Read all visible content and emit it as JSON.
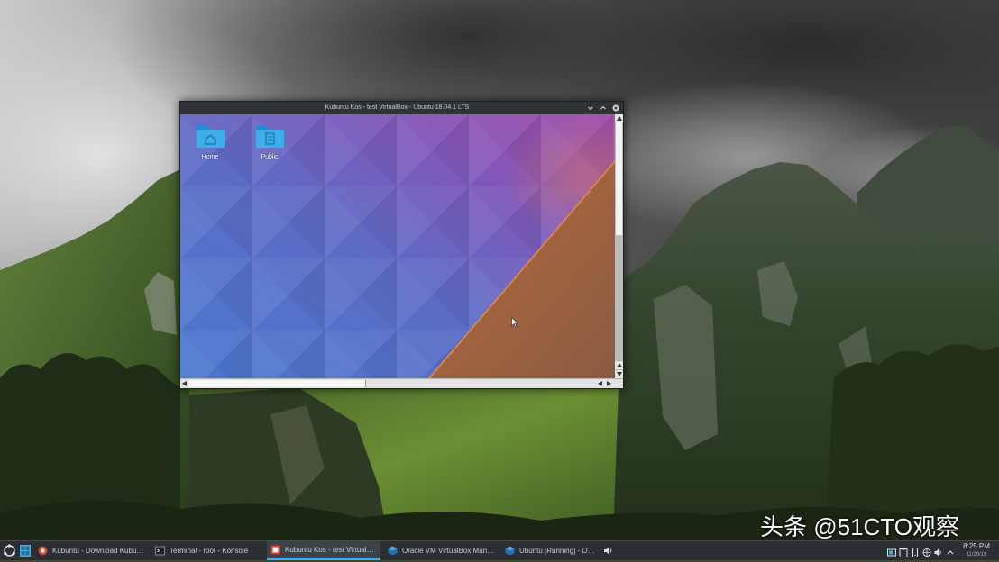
{
  "desktop": {
    "wallpaper": "mountain-landscape"
  },
  "vm_window": {
    "title": "Kubuntu Kos - test VirtualBox - Ubuntu 18.04.1 LTS",
    "controls": [
      "minimize-icon",
      "maximize-icon",
      "close-icon"
    ],
    "guest_desktop": {
      "wallpaper": "plasma-wallpaper",
      "icons": [
        {
          "label": "Home",
          "icon": "home-folder-icon"
        },
        {
          "label": "Public",
          "icon": "public-folder-icon"
        }
      ]
    }
  },
  "taskbar": {
    "launcher_icon": "kubuntu-logo-icon",
    "pager_icon": "desktop-pager-icon",
    "tasks": [
      {
        "label": "Kubuntu - Download Kubuntu",
        "icon": "browser-icon",
        "active": false
      },
      {
        "label": "Terminal - root - Konsole",
        "icon": "terminal-icon",
        "active": false
      },
      {
        "label": "Kubuntu Kos - test VirtualBox - Ubuntu 18.04.1 LTS",
        "icon": "virtualbox-vm-icon",
        "active": true
      },
      {
        "label": "Oracle VM VirtualBox Manager",
        "icon": "virtualbox-icon",
        "active": false
      },
      {
        "label": "Ubuntu [Running] - Oracle VM VirtualBox",
        "icon": "virtualbox-icon",
        "active": false
      }
    ],
    "audio_icon": "speaker-icon",
    "tray_icons": [
      "notifications-icon",
      "clipboard-icon",
      "kde-connect-icon",
      "network-icon",
      "volume-icon",
      "show-hidden-icons-icon"
    ],
    "clock": {
      "time": "8:25 PM",
      "date": "11/29/19"
    }
  },
  "watermark": "头条 @51CTO观察",
  "colors": {
    "accent": "#3daee9",
    "taskbar": "#2b2f34",
    "folder": "#3daee9",
    "titlebar": "#2f3237"
  }
}
